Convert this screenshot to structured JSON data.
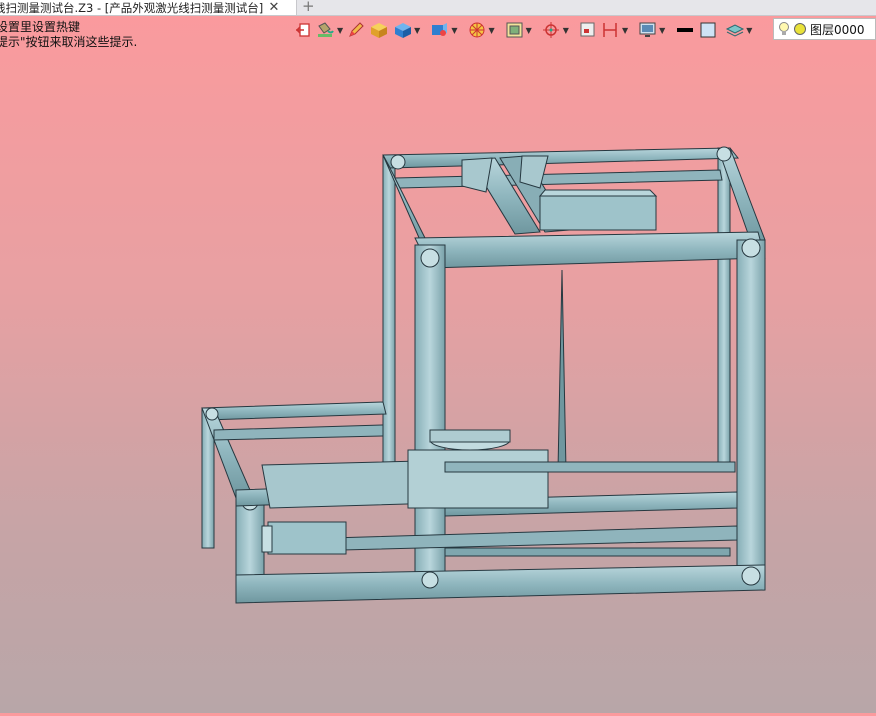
{
  "tab": {
    "title": "线扫测量测试台.Z3 - [产品外观激光线扫测量测试台]",
    "close_glyph": "✕",
    "new_glyph": "+"
  },
  "hints": {
    "line1": "设置里设置热键",
    "line2": "提示\"按钮来取消这些提示."
  },
  "toolbar": {
    "icons": [
      "exit-icon",
      "paint-bucket-icon",
      "pencil-icon",
      "box-icon",
      "cube-icon",
      "view-cube-icon",
      "render-icon",
      "frame-icon",
      "target-icon",
      "square-icon",
      "dimension-icon",
      "monitor-icon",
      "line-weight-icon",
      "color-swatch-icon",
      "layers-stack-icon"
    ]
  },
  "layer": {
    "label": "图层0000",
    "icons": [
      "bulb-icon",
      "layer-color-icon"
    ]
  },
  "colors": {
    "frame_fill": "#9bc1c8",
    "frame_stroke": "#2a3a40",
    "background_top": "#fb9a9d",
    "background_bottom": "#b8a6a8"
  }
}
